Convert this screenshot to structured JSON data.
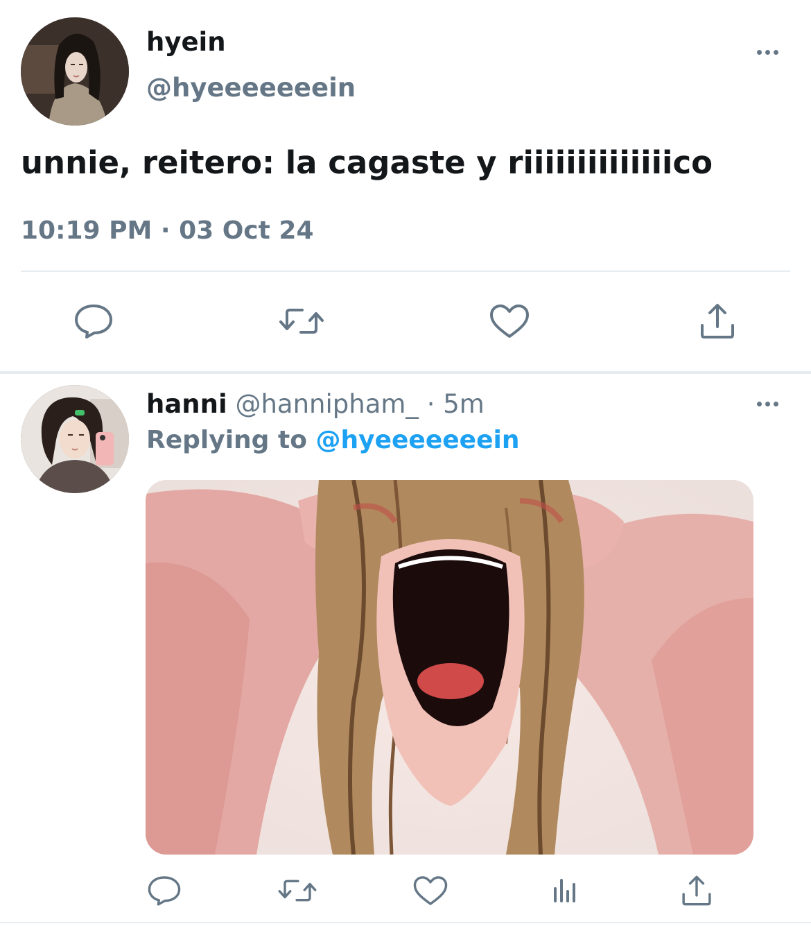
{
  "main_tweet": {
    "author": {
      "display_name": "hyein",
      "handle": "@hyeeeeeeein",
      "avatar_icon": "profile-photo"
    },
    "text": "unnie, reitero: la cagaste y riiiiiiiiiiiiiico",
    "timestamp": "10:19 PM · 03 Oct 24",
    "actions": [
      "reply-icon",
      "retweet-icon",
      "like-icon",
      "share-icon"
    ]
  },
  "reply_tweet": {
    "author": {
      "display_name": "hanni",
      "handle": "@hannipham_",
      "avatar_icon": "profile-photo"
    },
    "separator": "·",
    "time": "5m",
    "replying_label": "Replying to",
    "replying_handle": "@hyeeeeeeein",
    "media": {
      "kind": "image",
      "icon": "screaming-anime-character-image"
    },
    "actions": [
      "reply-icon",
      "retweet-icon",
      "like-icon",
      "analytics-icon",
      "share-icon"
    ]
  },
  "colors": {
    "text_primary": "#14171a",
    "text_secondary": "#657786",
    "link": "#1da1f2",
    "divider": "#e6ecf0",
    "icon": "#657786"
  }
}
